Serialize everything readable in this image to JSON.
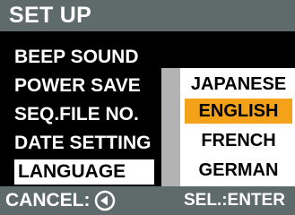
{
  "title": "SET UP",
  "menu": {
    "items": [
      {
        "label": "BEEP SOUND"
      },
      {
        "label": "POWER SAVE"
      },
      {
        "label": "SEQ.FILE NO."
      },
      {
        "label": "DATE SETTING"
      },
      {
        "label": "LANGUAGE"
      }
    ],
    "selected_label": "LANGUAGE"
  },
  "submenu": {
    "items": [
      {
        "label": "JAPANESE"
      },
      {
        "label": "ENGLISH"
      },
      {
        "label": "FRENCH"
      },
      {
        "label": "GERMAN"
      }
    ],
    "highlighted_label": "ENGLISH"
  },
  "footer": {
    "cancel_label": "CANCEL:",
    "cancel_icon": "left-arrow-circle-icon",
    "select_label": "SEL.:ENTER"
  },
  "colors": {
    "bar": "#5f6a6a",
    "highlight": "#f3a21a",
    "background": "#000000",
    "selection": "#ffffff",
    "scroll": "#b3b3b3"
  }
}
